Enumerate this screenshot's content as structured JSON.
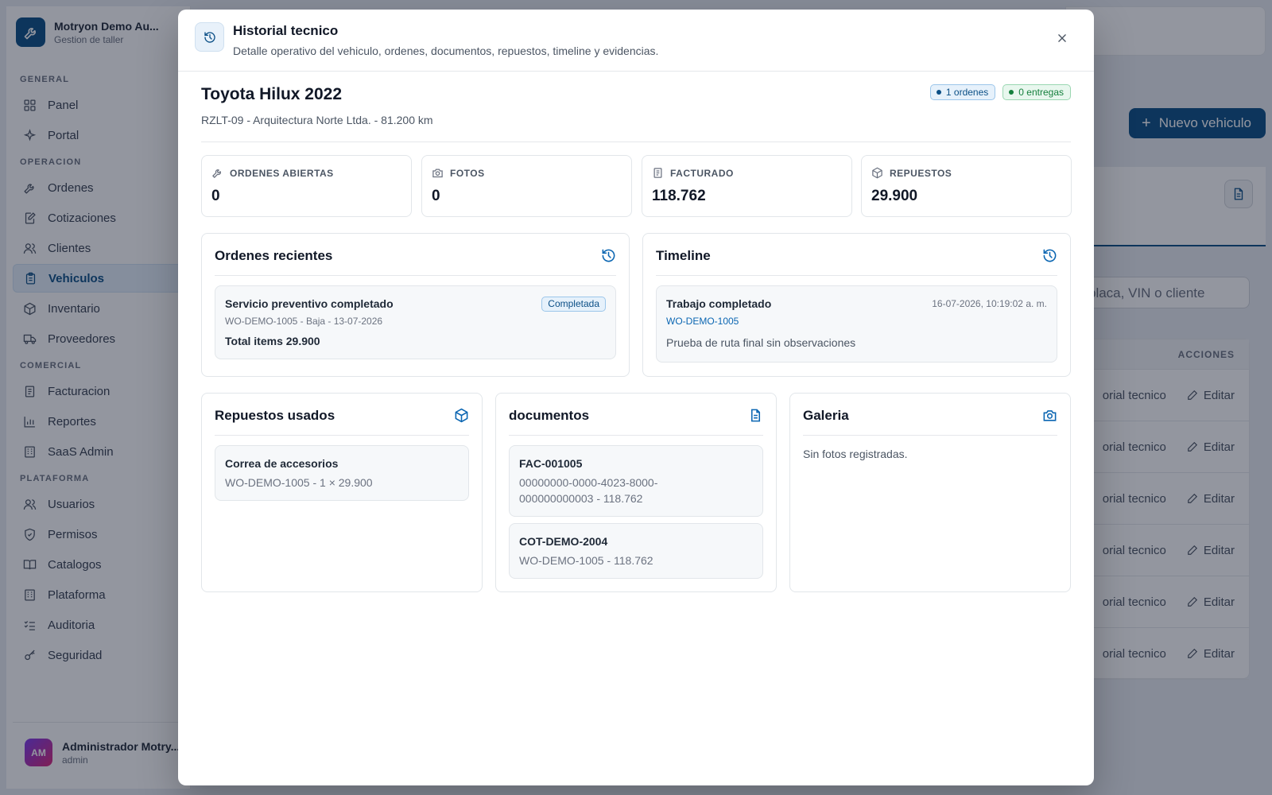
{
  "app": {
    "brand_name": "Motryon Demo Au...",
    "brand_sub": "Gestion de taller",
    "nav": [
      {
        "section": "GENERAL",
        "items": [
          {
            "label": "Panel",
            "icon": "grid-icon"
          },
          {
            "label": "Portal",
            "icon": "sparkle-icon"
          }
        ]
      },
      {
        "section": "OPERACION",
        "items": [
          {
            "label": "Ordenes",
            "icon": "wrench-icon"
          },
          {
            "label": "Cotizaciones",
            "icon": "edit-doc-icon"
          },
          {
            "label": "Clientes",
            "icon": "users-icon"
          },
          {
            "label": "Vehiculos",
            "icon": "clipboard-icon",
            "active": true
          },
          {
            "label": "Inventario",
            "icon": "box-icon"
          },
          {
            "label": "Proveedores",
            "icon": "truck-icon"
          }
        ]
      },
      {
        "section": "COMERCIAL",
        "items": [
          {
            "label": "Facturacion",
            "icon": "receipt-icon"
          },
          {
            "label": "Reportes",
            "icon": "bar-chart-icon"
          },
          {
            "label": "SaaS Admin",
            "icon": "building-icon"
          }
        ]
      },
      {
        "section": "PLATAFORMA",
        "items": [
          {
            "label": "Usuarios",
            "icon": "users-icon"
          },
          {
            "label": "Permisos",
            "icon": "shield-icon"
          },
          {
            "label": "Catalogos",
            "icon": "book-icon"
          },
          {
            "label": "Plataforma",
            "icon": "building-icon"
          },
          {
            "label": "Auditoria",
            "icon": "list-check-icon"
          },
          {
            "label": "Seguridad",
            "icon": "key-icon"
          }
        ]
      }
    ],
    "user": {
      "initials": "AM",
      "name": "Administrador Motry...",
      "role": "admin"
    },
    "new_vehicle_label": "Nuevo vehiculo",
    "search_placeholder": "placa, VIN o cliente",
    "actions_header": "ACCIONES",
    "row_history_label": "orial tecnico",
    "row_edit_label": "Editar",
    "row_count": 6
  },
  "modal": {
    "title": "Historial tecnico",
    "subtitle": "Detalle operativo del vehiculo, ordenes, documentos, repuestos, timeline y evidencias.",
    "vehicle": {
      "name": "Toyota Hilux 2022",
      "details": "RZLT-09 - Arquitectura Norte Ltda. - 81.200 km"
    },
    "badges": {
      "orders": "1 ordenes",
      "deliveries": "0 entregas"
    },
    "stats": [
      {
        "label": "ORDENES ABIERTAS",
        "value": "0",
        "icon": "wrench-icon"
      },
      {
        "label": "FOTOS",
        "value": "0",
        "icon": "camera-icon"
      },
      {
        "label": "FACTURADO",
        "value": "118.762",
        "icon": "receipt-icon"
      },
      {
        "label": "REPUESTOS",
        "value": "29.900",
        "icon": "box-icon"
      }
    ],
    "recent_orders": {
      "title": "Ordenes recientes",
      "item": {
        "title": "Servicio preventivo completado",
        "meta": "WO-DEMO-1005 - Baja - 13-07-2026",
        "total": "Total items 29.900",
        "status": "Completada"
      }
    },
    "timeline": {
      "title": "Timeline",
      "item": {
        "title": "Trabajo completado",
        "date": "16-07-2026, 10:19:02 a. m.",
        "ref": "WO-DEMO-1005",
        "note": "Prueba de ruta final sin observaciones"
      }
    },
    "parts": {
      "title": "Repuestos usados",
      "item": {
        "title": "Correa de accesorios",
        "meta": "WO-DEMO-1005 - 1 × 29.900"
      }
    },
    "documents": {
      "title": "documentos",
      "items": [
        {
          "title": "FAC-001005",
          "line1": "00000000-0000-4023-8000-",
          "line2": "000000000003 - 118.762"
        },
        {
          "title": "COT-DEMO-2004",
          "line1": "WO-DEMO-1005 - 118.762"
        }
      ]
    },
    "gallery": {
      "title": "Galeria",
      "empty": "Sin fotos registradas."
    }
  }
}
